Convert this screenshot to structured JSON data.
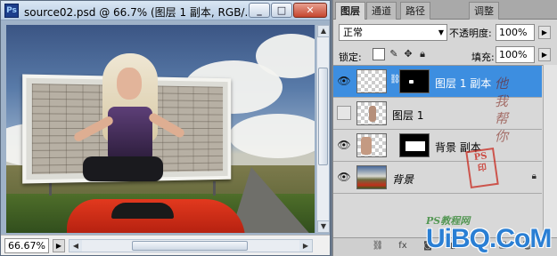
{
  "document": {
    "app_icon": "Ps",
    "title": "source02.psd @ 66.7% (图层 1 副本, RGB/...",
    "zoom": "66.67%",
    "window_buttons": {
      "minimize": "_",
      "maximize": "□",
      "close": "✕"
    }
  },
  "panel": {
    "tabs": [
      "图层",
      "通道",
      "路径",
      "调整"
    ],
    "blend_mode": "正常",
    "opacity_label": "不透明度:",
    "opacity_value": "100%",
    "lock_label": "锁定:",
    "fill_label": "填充:",
    "fill_value": "100%",
    "layers": [
      {
        "name": "图层 1 副本",
        "visible": true,
        "active": true,
        "has_mask": true,
        "mask_style": "small-white-mark"
      },
      {
        "name": "图层 1",
        "visible": false,
        "active": false,
        "has_mask": false
      },
      {
        "name": "背景 副本",
        "visible": true,
        "active": false,
        "has_mask": true,
        "mask_style": "white-rect"
      },
      {
        "name": "背景",
        "visible": true,
        "active": false,
        "has_mask": false,
        "locked": true
      }
    ]
  },
  "watermarks": {
    "calligraphy": "他 我 帮 你",
    "ps_text": "PS教程网",
    "uibq": "UiBQ.CoM"
  },
  "colors": {
    "active_layer": "#3d8ee0",
    "panel_bg": "#d6d6d6",
    "uibq_blue": "#2a7fd4"
  }
}
